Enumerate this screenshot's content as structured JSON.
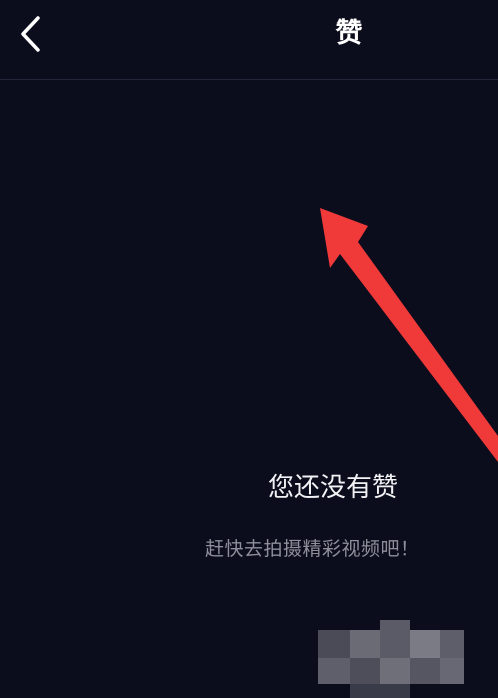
{
  "header": {
    "title": "赞",
    "back_icon": "chevron-left-icon"
  },
  "empty_state": {
    "title": "您还没有赞",
    "subtitle": "赶快去拍摄精彩视频吧！"
  },
  "colors": {
    "background": "#0b0c1c",
    "divider": "#23253a",
    "title_text": "#f2f2f4",
    "subtitle_text": "#8e8f9a",
    "annotation_arrow": "#f03a3a"
  }
}
